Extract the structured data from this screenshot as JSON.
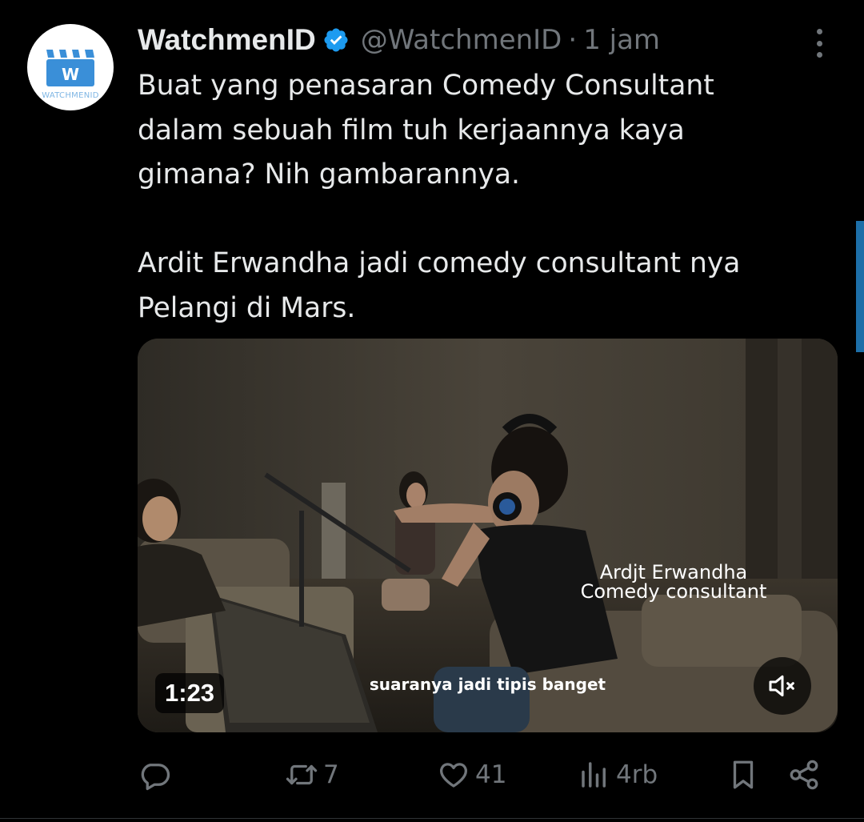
{
  "account": {
    "name": "WatchmenID",
    "handle": "@WatchmenID",
    "separator": "·",
    "time": "1 jam",
    "avatar_letter": "W",
    "avatar_text": "WATCHMENID"
  },
  "tweet": {
    "text": "Buat yang penasaran Comedy Consultant\ndalam sebuah film tuh kerjaannya kaya\ngimana? Nih gambarannya.\n\nArdit Erwandha jadi comedy consultant nya\nPelangi di Mars."
  },
  "video": {
    "overlay_line1": "Ardjt  Erwandha",
    "overlay_line2": "Comedy consultant",
    "subtitle": "suaranya jadi tipis banget",
    "duration": "1:23",
    "muted": true
  },
  "actions": {
    "reply_count": "",
    "retweet_count": "7",
    "like_count": "41",
    "views_count": "4rb"
  },
  "colors": {
    "background": "#000000",
    "text_primary": "#e7e9ea",
    "text_secondary": "#71767b",
    "verified": "#1d9bf0",
    "brand_blue": "#3a8fd8"
  },
  "icons": [
    "more-options-icon",
    "verified-badge-icon",
    "reply-icon",
    "retweet-icon",
    "like-icon",
    "views-icon",
    "bookmark-icon",
    "share-icon",
    "mute-icon"
  ]
}
